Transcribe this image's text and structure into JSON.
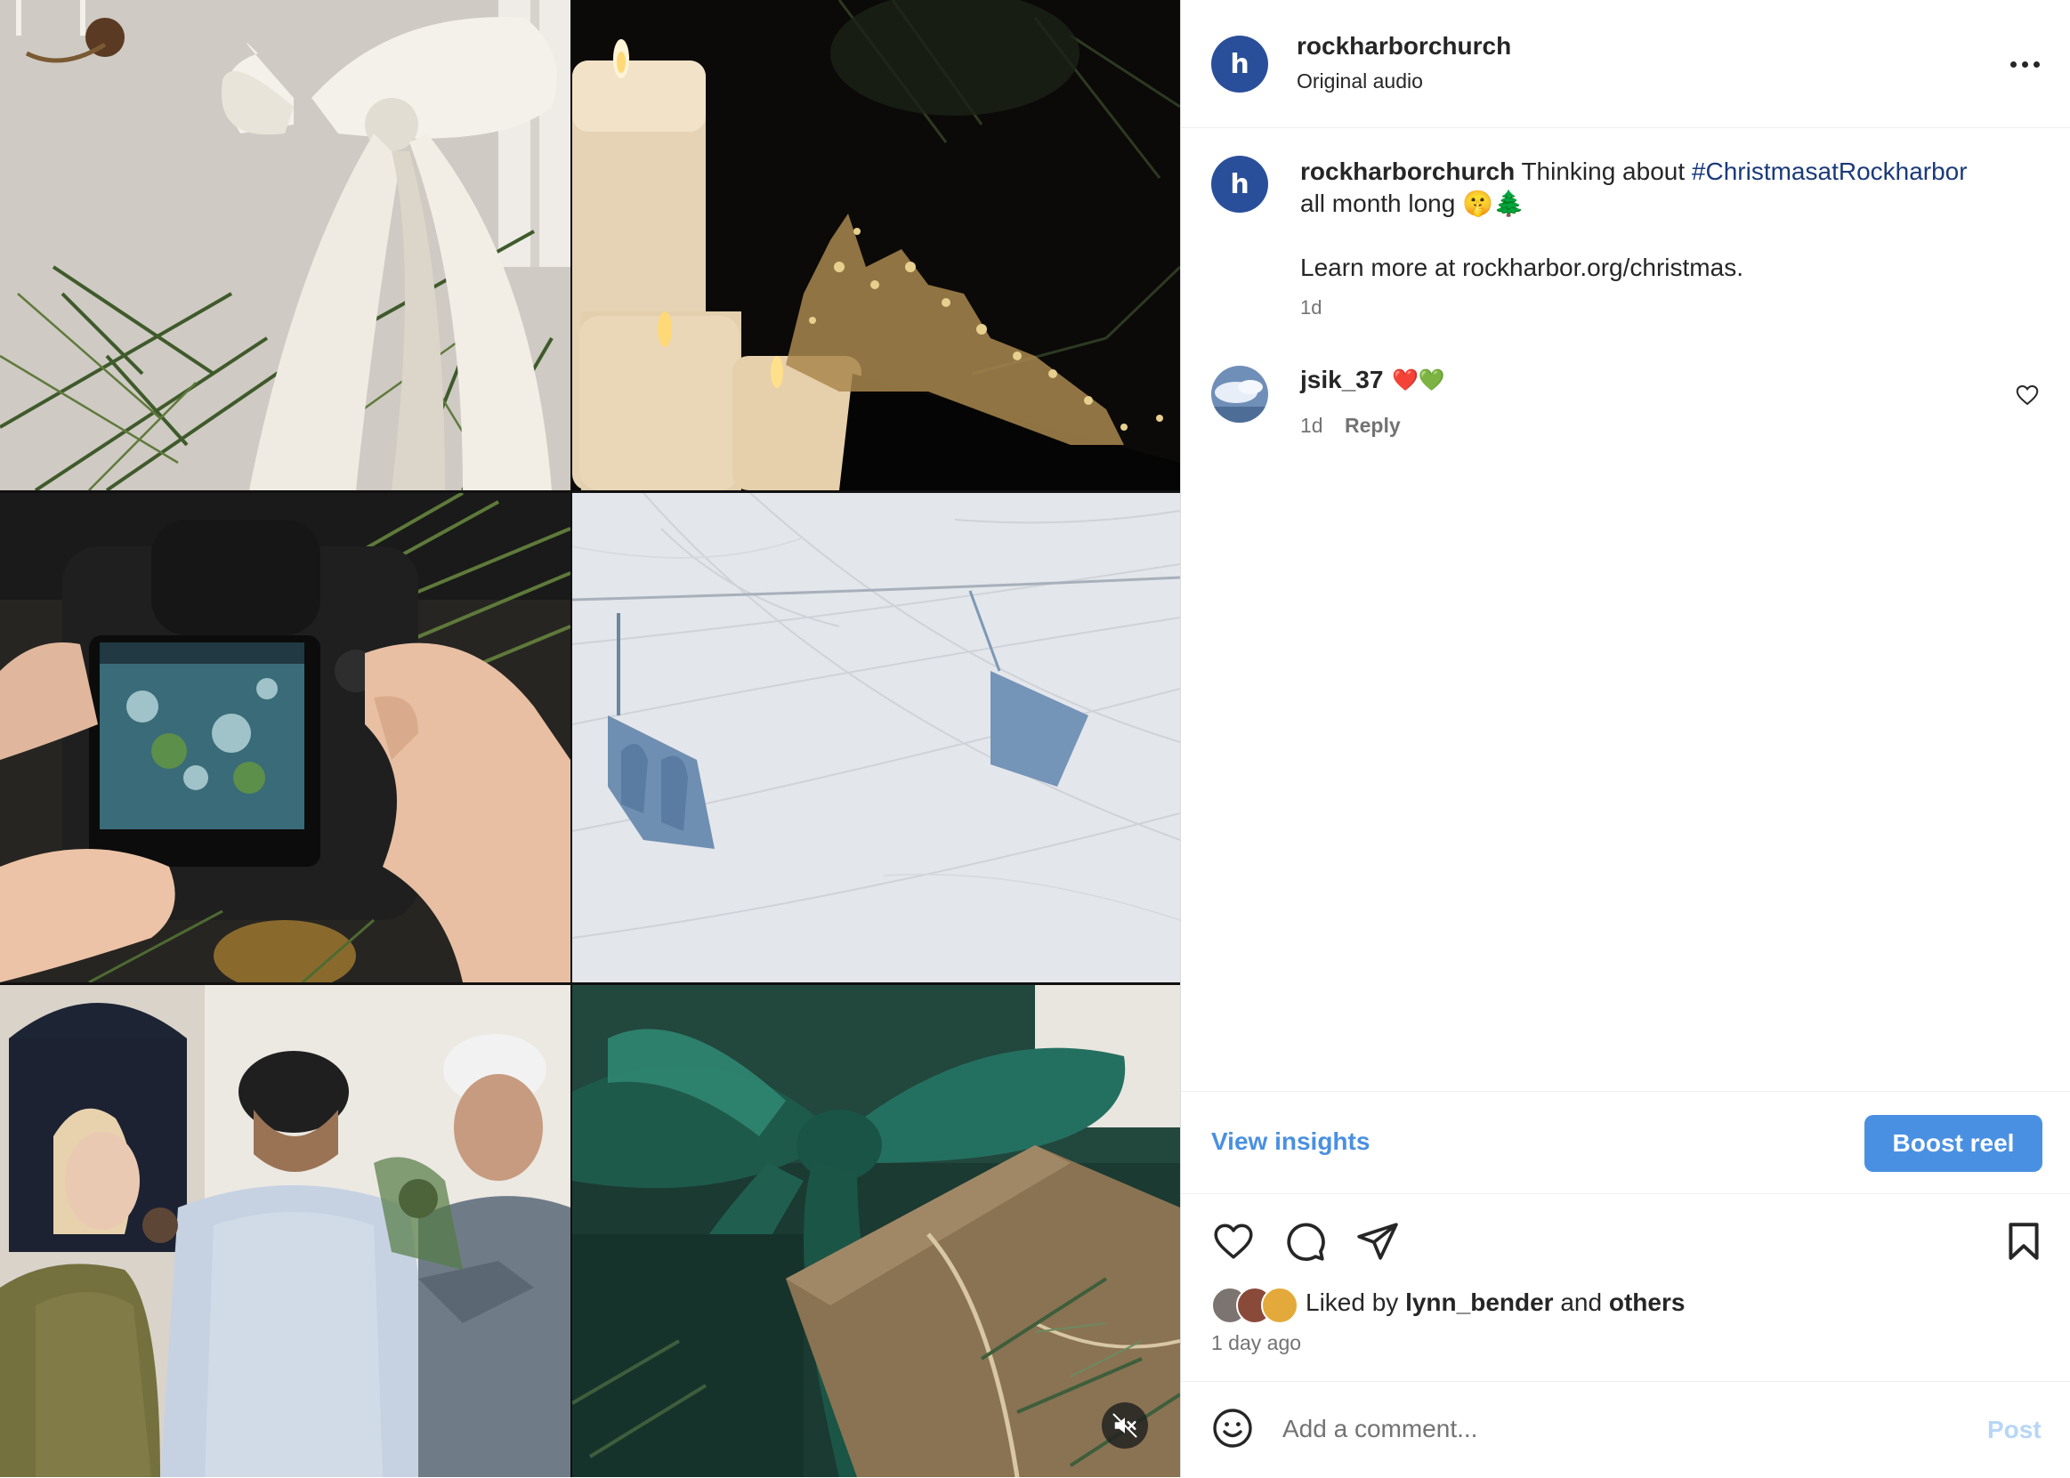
{
  "post": {
    "username": "rockharborchurch",
    "audio": "Original audio",
    "avatar_letter": "h"
  },
  "caption": {
    "username": "rockharborchurch",
    "text_before": " Thinking about ",
    "hashtag": "#ChristmasatRockharbor",
    "line2": "all month long 🤫🌲",
    "learn_more": "Learn more at rockharbor.org/christmas.",
    "time": "1d"
  },
  "comment": {
    "username": "jsik_37",
    "text": "❤️💚",
    "time": "1d",
    "reply_label": "Reply"
  },
  "actions": {
    "insights_label": "View insights",
    "boost_label": "Boost reel"
  },
  "likes": {
    "prefix": "Liked by ",
    "user": "lynn_bender",
    "middle": " and ",
    "others": "others",
    "time_ago": "1 day ago"
  },
  "add_comment": {
    "placeholder": "Add a comment...",
    "post_label": "Post"
  },
  "colors": {
    "link_blue": "#4a90e2",
    "avatar_blue": "#2a4f9a",
    "hashtag": "#1a3a7a"
  }
}
